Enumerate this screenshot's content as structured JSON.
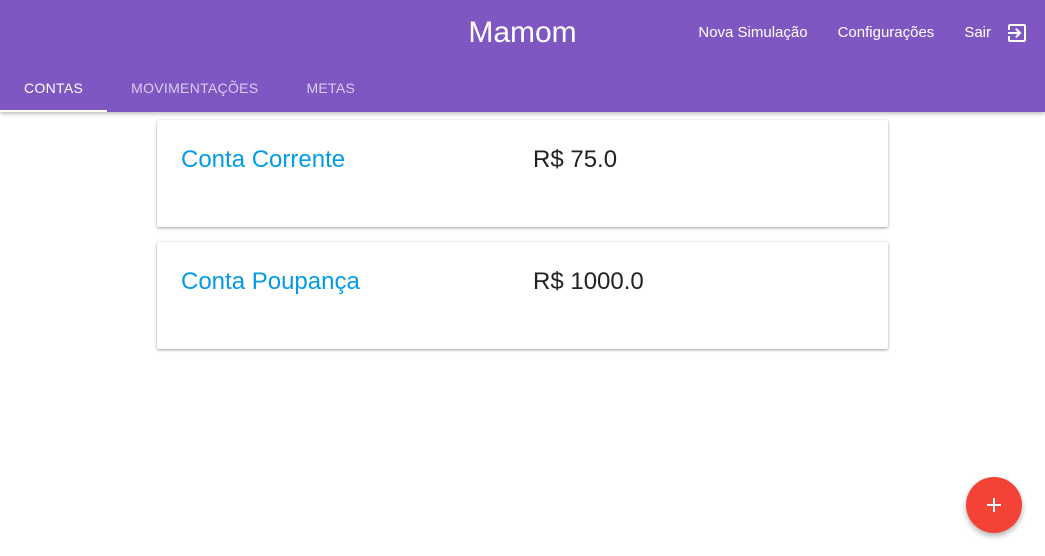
{
  "app": {
    "title": "Mamom"
  },
  "top_nav": {
    "new_simulation": "Nova Simulação",
    "settings": "Configurações",
    "logout": "Sair",
    "logout_icon": "exit-to-app-icon"
  },
  "tabs": [
    {
      "label": "Contas",
      "active": true
    },
    {
      "label": "Movimentações",
      "active": false
    },
    {
      "label": "Metas",
      "active": false
    }
  ],
  "accounts": [
    {
      "name": "Conta Corrente",
      "balance": "R$ 75.0"
    },
    {
      "name": "Conta Poupança",
      "balance": "R$ 1000.0"
    }
  ],
  "fab": {
    "icon": "add-icon"
  },
  "colors": {
    "primary": "#7e57c2",
    "link": "#039be5",
    "fab": "#f44336"
  }
}
